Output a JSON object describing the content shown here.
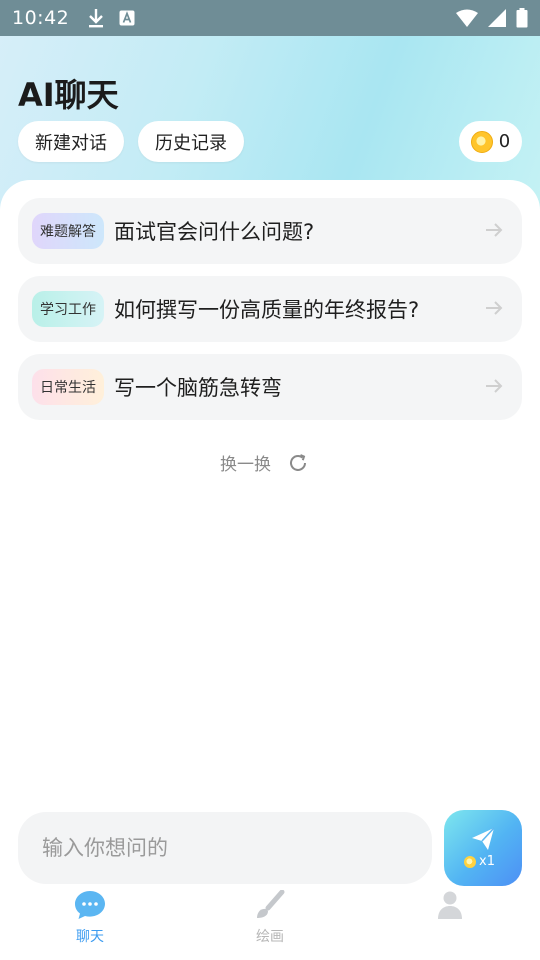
{
  "status_bar": {
    "time": "10:42"
  },
  "header": {
    "title": "AI聊天",
    "new_chat_label": "新建对话",
    "history_label": "历史记录",
    "coin_count": "0"
  },
  "prompts": [
    {
      "tag": "难题解答",
      "text": "面试官会问什么问题?"
    },
    {
      "tag": "学习工作",
      "text": "如何撰写一份高质量的年终报告?"
    },
    {
      "tag": "日常生活",
      "text": "写一个脑筋急转弯"
    }
  ],
  "refresh_label": "换一换",
  "input": {
    "placeholder": "输入你想问的",
    "value": ""
  },
  "send": {
    "cost_label": "x1"
  },
  "nav": {
    "chat_label": "聊天",
    "draw_label": "绘画"
  },
  "colors": {
    "accent": "#3d9cf0",
    "send_gradient_start": "#7ee7ee",
    "send_gradient_end": "#4d8ff5"
  }
}
